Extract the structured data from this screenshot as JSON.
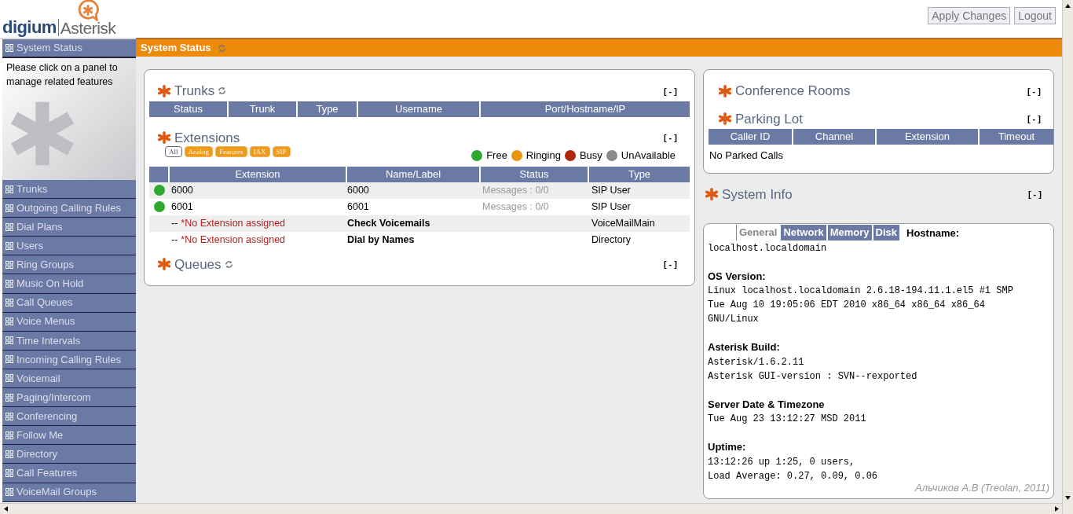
{
  "logo": {
    "brand": "digium",
    "product": "Asterisk"
  },
  "header_buttons": [
    "Apply Changes",
    "Logout"
  ],
  "sidebar": {
    "title": "System Status",
    "description": "Please click on a panel to manage related features",
    "items": [
      "Trunks",
      "Outgoing Calling Rules",
      "Dial Plans",
      "Users",
      "Ring Groups",
      "Music On Hold",
      "Call Queues",
      "Voice Menus",
      "Time Intervals",
      "Incoming Calling Rules",
      "Voicemail",
      "Paging/Intercom",
      "Conferencing",
      "Follow Me",
      "Directory",
      "Call Features",
      "VoiceMail Groups"
    ]
  },
  "page_title": "System Status",
  "trunks": {
    "title": "Trunks",
    "toggle": "[ - ]",
    "columns": [
      "Status",
      "Trunk",
      "Type",
      "Username",
      "Port/Hostname/IP"
    ]
  },
  "extensions": {
    "title": "Extensions",
    "toggle": "[ - ]",
    "filters": [
      {
        "label": "All",
        "selected": true
      },
      {
        "label": "Analog",
        "selected": false
      },
      {
        "label": "Features",
        "selected": false
      },
      {
        "label": "IAX",
        "selected": false
      },
      {
        "label": "SIP",
        "selected": false
      }
    ],
    "legend": [
      {
        "label": "Free",
        "color": "#2ea82e"
      },
      {
        "label": "Ringing",
        "color": "#e8960c"
      },
      {
        "label": "Busy",
        "color": "#b0250c"
      },
      {
        "label": "UnAvailable",
        "color": "#8a8a8a"
      }
    ],
    "columns": [
      "Extension",
      "Name/Label",
      "Status",
      "Type"
    ],
    "rows": [
      {
        "kind": "user",
        "color": "#2ea82e",
        "extension": "6000",
        "name": "6000",
        "status": "Messages : 0/0",
        "type": "SIP User"
      },
      {
        "kind": "user",
        "color": "#2ea82e",
        "extension": "6001",
        "name": "6001",
        "status": "Messages : 0/0",
        "type": "SIP User"
      },
      {
        "kind": "feature",
        "prefix": "--",
        "extension": "*No Extension assigned",
        "name": "Check Voicemails",
        "type": "VoiceMailMain"
      },
      {
        "kind": "feature",
        "prefix": "--",
        "extension": "*No Extension assigned",
        "name": "Dial by Names",
        "type": "Directory"
      }
    ]
  },
  "queues": {
    "title": "Queues",
    "toggle": "[ - ]"
  },
  "conference_rooms": {
    "title": "Conference Rooms",
    "toggle": "[ - ]"
  },
  "parking_lot": {
    "title": "Parking Lot",
    "toggle": "[ - ]",
    "columns": [
      "Caller ID",
      "Channel",
      "Extension",
      "Timeout"
    ],
    "empty_message": "No Parked Calls"
  },
  "system_info": {
    "title": "System Info",
    "toggle": "[ - ]",
    "tabs": [
      {
        "label": "General",
        "selected": true
      },
      {
        "label": "Network",
        "selected": false
      },
      {
        "label": "Memory",
        "selected": false
      },
      {
        "label": "Disk",
        "selected": false
      }
    ],
    "sections": [
      {
        "heading": "Hostname:",
        "lines": [
          "localhost.localdomain"
        ]
      },
      {
        "heading": "OS Version:",
        "lines": [
          "Linux localhost.localdomain 2.6.18-194.11.1.el5 #1 SMP",
          "Tue Aug 10 19:05:06 EDT 2010 x86_64 x86_64 x86_64",
          "GNU/Linux"
        ]
      },
      {
        "heading": "Asterisk Build:",
        "lines": [
          "Asterisk/1.6.2.11",
          "Asterisk GUI-version : SVN--rexported"
        ]
      },
      {
        "heading": "Server Date & Timezone",
        "lines": [
          "Tue Aug 23 13:12:27 MSD 2011"
        ]
      },
      {
        "heading": "Uptime:",
        "lines": [
          "13:12:26 up 1:25, 0 users,",
          "Load Average: 0.27, 0.09, 0.06"
        ]
      }
    ],
    "credit": "Альчиков А.В (Treolan, 2011)"
  }
}
